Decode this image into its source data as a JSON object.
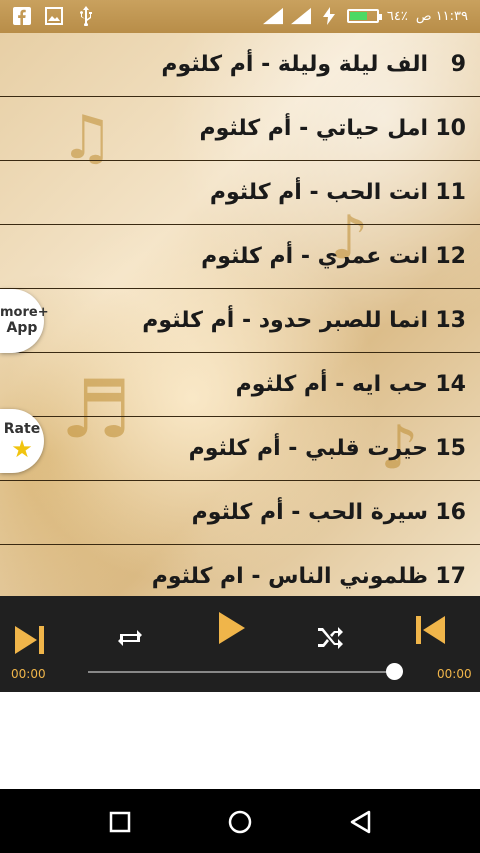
{
  "status_bar": {
    "time": "١١:٣٩ ص",
    "battery_label": "٦٤٪",
    "battery_level": 0.64,
    "left_icons": [
      "facebook-icon",
      "image-icon",
      "usb-icon"
    ],
    "right_icons": [
      "signal-icon",
      "signal-icon",
      "charging-icon"
    ]
  },
  "tracks": [
    {
      "number": "9",
      "title": "الف ليلة وليلة - أم كلثوم"
    },
    {
      "number": "10",
      "title": "امل حياتي - أم كلثوم"
    },
    {
      "number": "11",
      "title": "انت الحب - أم كلثوم"
    },
    {
      "number": "12",
      "title": "انت عمري - أم كلثوم"
    },
    {
      "number": "13",
      "title": "انما للصبر حدود - أم كلثوم"
    },
    {
      "number": "14",
      "title": "حب ايه - أم كلثوم"
    },
    {
      "number": "15",
      "title": "حيرت قلبي - أم كلثوم"
    },
    {
      "number": "16",
      "title": "سيرة الحب - أم كلثوم"
    },
    {
      "number": "17",
      "title": "ظلموني الناس - ام كلثوم"
    }
  ],
  "side_buttons": {
    "more_apps": {
      "line1": "more+",
      "line2": "App"
    },
    "rate": {
      "label": "Rate"
    }
  },
  "player": {
    "time_elapsed": "00:00",
    "time_total": "00:00",
    "progress": 0.0,
    "accent_color": "#f0b54a"
  },
  "nav_bar": {
    "icons": [
      "recents-icon",
      "home-icon",
      "back-icon"
    ]
  }
}
